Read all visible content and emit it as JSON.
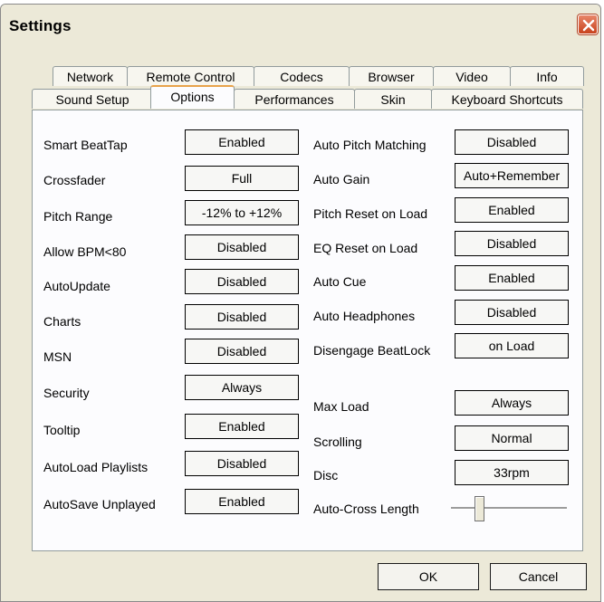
{
  "window": {
    "title": "Settings"
  },
  "tabs_row1": [
    "Network",
    "Remote Control",
    "Codecs",
    "Browser",
    "Video",
    "Info"
  ],
  "tabs_row2": [
    "Sound Setup",
    "Options",
    "Performances",
    "Skin",
    "Keyboard Shortcuts"
  ],
  "active_tab": "Options",
  "left_settings": [
    {
      "label": "Smart BeatTap",
      "value": "Enabled"
    },
    {
      "label": "Crossfader",
      "value": "Full"
    },
    {
      "label": "Pitch Range",
      "value": "-12% to +12%"
    },
    {
      "label": "Allow BPM<80",
      "value": "Disabled"
    },
    {
      "label": "AutoUpdate",
      "value": "Disabled"
    },
    {
      "label": "Charts",
      "value": "Disabled"
    },
    {
      "label": "MSN",
      "value": "Disabled"
    },
    {
      "label": "Security",
      "value": "Always"
    },
    {
      "label": "Tooltip",
      "value": "Enabled"
    },
    {
      "label": "AutoLoad Playlists",
      "value": "Disabled"
    },
    {
      "label": "AutoSave Unplayed",
      "value": "Enabled"
    }
  ],
  "right_settings": [
    {
      "label": "Auto Pitch Matching",
      "value": "Disabled"
    },
    {
      "label": "Auto Gain",
      "value": "Auto+Remember"
    },
    {
      "label": "Pitch Reset on Load",
      "value": "Enabled"
    },
    {
      "label": "EQ Reset on Load",
      "value": "Disabled"
    },
    {
      "label": "Auto Cue",
      "value": "Enabled"
    },
    {
      "label": "Auto Headphones",
      "value": "Disabled"
    },
    {
      "label": "Disengage BeatLock",
      "value": "on Load"
    },
    {
      "label": "Max Load",
      "value": "Always"
    },
    {
      "label": "Scrolling",
      "value": "Normal"
    },
    {
      "label": "Disc",
      "value": "33rpm"
    }
  ],
  "auto_cross_length": {
    "label": "Auto-Cross Length",
    "level": 0.22
  },
  "buttons": {
    "ok": "OK",
    "cancel": "Cancel"
  },
  "colors": {
    "window_bg": "#ece9d8",
    "panel_bg": "#fcfcfe",
    "active_tab_accent": "#e8a34b",
    "close_button": "#c8421c"
  }
}
